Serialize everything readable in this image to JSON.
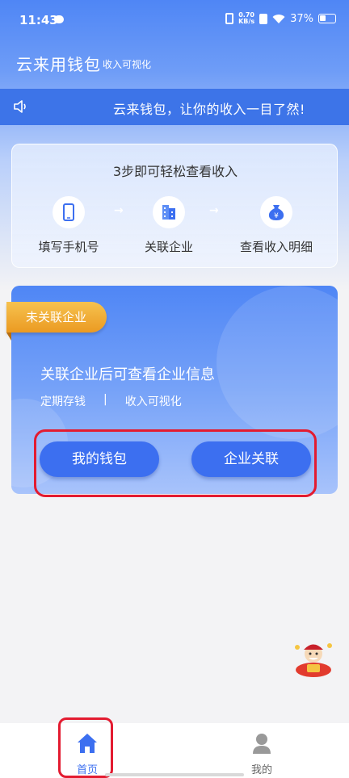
{
  "status_bar": {
    "time": "11:43",
    "speed_top": "0.70",
    "speed_unit": "KB/s",
    "battery": "37%"
  },
  "header": {
    "title": "云来用钱包",
    "subtitle": "收入可视化"
  },
  "notice": {
    "text": "云来钱包，让你的收入一目了然!",
    "icon": "speaker-icon"
  },
  "steps": {
    "title": "3步即可轻松查看收入",
    "items": [
      {
        "label": "填写手机号",
        "icon": "phone-icon"
      },
      {
        "label": "关联企业",
        "icon": "building-icon"
      },
      {
        "label": "查看收入明细",
        "icon": "money-bag-icon"
      }
    ],
    "arrow": "→"
  },
  "enterprise_card": {
    "badge": "未关联企业",
    "heading": "关联企业后可查看企业信息",
    "tags": [
      "定期存钱",
      "收入可视化"
    ],
    "tag_separator": "|",
    "buttons": {
      "wallet": "我的钱包",
      "link": "企业关联"
    }
  },
  "tabbar": {
    "items": [
      {
        "label": "首页",
        "icon": "home-icon",
        "active": true
      },
      {
        "label": "我的",
        "icon": "user-icon",
        "active": false
      }
    ]
  },
  "colors": {
    "primary": "#3c6ff0",
    "banner": "#3d74e8",
    "badge_orange": "#eb9a22",
    "highlight_red": "#e31b30",
    "tab_active": "#3c6ff0",
    "tab_inactive": "#999999"
  }
}
